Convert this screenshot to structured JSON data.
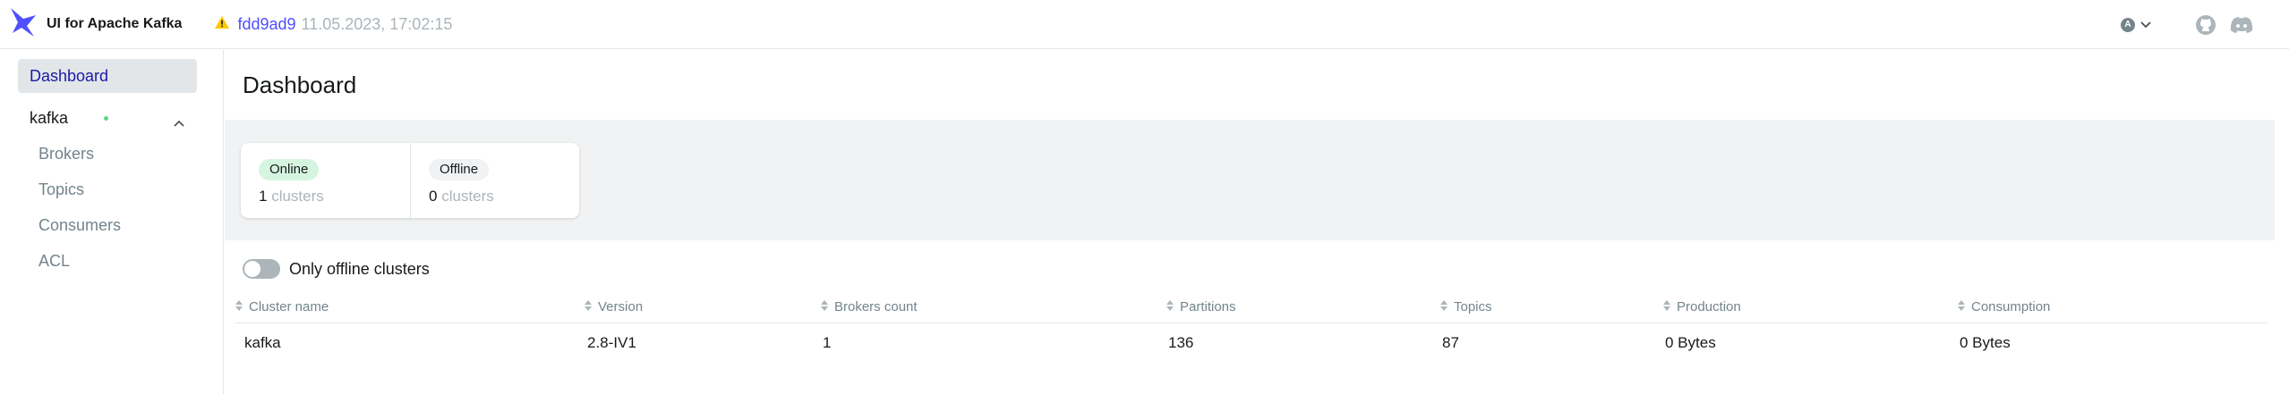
{
  "app": {
    "title": "UI for Apache Kafka",
    "version_hash": "fdd9ad9",
    "version_date": "11.05.2023, 17:02:15",
    "user_initial": "A"
  },
  "sidebar": {
    "dashboard_label": "Dashboard",
    "cluster_name": "kafka",
    "cluster_status_color": "#5cd685",
    "items": [
      {
        "label": "Brokers"
      },
      {
        "label": "Topics"
      },
      {
        "label": "Consumers"
      },
      {
        "label": "ACL"
      }
    ]
  },
  "main": {
    "title": "Dashboard",
    "metrics": {
      "online": {
        "label": "Online",
        "value": "1",
        "unit": "clusters"
      },
      "offline": {
        "label": "Offline",
        "value": "0",
        "unit": "clusters"
      }
    },
    "toggle_label": "Only offline clusters",
    "table": {
      "columns": [
        "Cluster name",
        "Version",
        "Brokers count",
        "Partitions",
        "Topics",
        "Production",
        "Consumption"
      ],
      "rows": [
        [
          "kafka",
          "2.8-IV1",
          "1",
          "136",
          "87",
          "0 Bytes",
          "0 Bytes"
        ]
      ]
    }
  },
  "colors": {
    "accent": "#4f4ffe",
    "brand": "#4f4ffe",
    "online_badge": "#d6f5e0",
    "warning": "#ffc700"
  },
  "icons": [
    "kafka-logo-icon",
    "warning-icon",
    "chevron-down-icon",
    "github-icon",
    "discord-icon",
    "chevron-up-icon",
    "sort-icon"
  ]
}
